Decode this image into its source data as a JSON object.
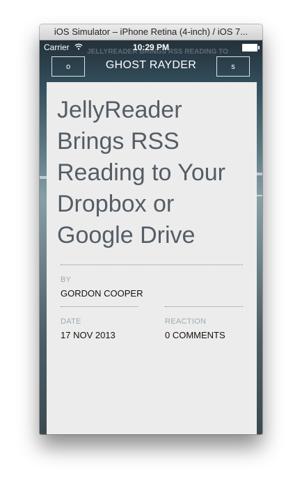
{
  "window": {
    "title": "iOS Simulator – iPhone Retina (4-inch) / iOS 7..."
  },
  "statusbar": {
    "carrier": "Carrier",
    "wifi_icon": "wifi-icon",
    "time": "10:29 PM"
  },
  "navbar": {
    "left_button": "o",
    "title": "GHOST RAYDER",
    "right_button": "s",
    "background_text": "JELLYREADER BRINGS RSS READING TO"
  },
  "article": {
    "title": "JellyReader Brings RSS Reading to Your Dropbox or Google Drive",
    "by_label": "BY",
    "author": "GORDON COOPER",
    "date_label": "DATE",
    "date": "17 NOV 2013",
    "reaction_label": "REACTION",
    "reaction": "0 COMMENTS"
  },
  "colors": {
    "title_text": "#555d66",
    "label_text": "#9aabb3",
    "card_bg": "#ececec"
  }
}
